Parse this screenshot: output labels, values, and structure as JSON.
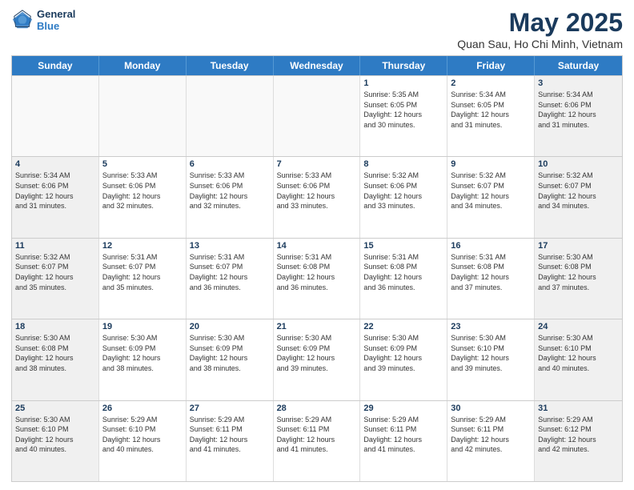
{
  "header": {
    "logo": {
      "general": "General",
      "blue": "Blue"
    },
    "title": "May 2025",
    "subtitle": "Quan Sau, Ho Chi Minh, Vietnam"
  },
  "days": [
    "Sunday",
    "Monday",
    "Tuesday",
    "Wednesday",
    "Thursday",
    "Friday",
    "Saturday"
  ],
  "weeks": [
    [
      {
        "day": "",
        "lines": []
      },
      {
        "day": "",
        "lines": []
      },
      {
        "day": "",
        "lines": []
      },
      {
        "day": "",
        "lines": []
      },
      {
        "day": "1",
        "lines": [
          "Sunrise: 5:35 AM",
          "Sunset: 6:05 PM",
          "Daylight: 12 hours",
          "and 30 minutes."
        ]
      },
      {
        "day": "2",
        "lines": [
          "Sunrise: 5:34 AM",
          "Sunset: 6:05 PM",
          "Daylight: 12 hours",
          "and 31 minutes."
        ]
      },
      {
        "day": "3",
        "lines": [
          "Sunrise: 5:34 AM",
          "Sunset: 6:06 PM",
          "Daylight: 12 hours",
          "and 31 minutes."
        ]
      }
    ],
    [
      {
        "day": "4",
        "lines": [
          "Sunrise: 5:34 AM",
          "Sunset: 6:06 PM",
          "Daylight: 12 hours",
          "and 31 minutes."
        ]
      },
      {
        "day": "5",
        "lines": [
          "Sunrise: 5:33 AM",
          "Sunset: 6:06 PM",
          "Daylight: 12 hours",
          "and 32 minutes."
        ]
      },
      {
        "day": "6",
        "lines": [
          "Sunrise: 5:33 AM",
          "Sunset: 6:06 PM",
          "Daylight: 12 hours",
          "and 32 minutes."
        ]
      },
      {
        "day": "7",
        "lines": [
          "Sunrise: 5:33 AM",
          "Sunset: 6:06 PM",
          "Daylight: 12 hours",
          "and 33 minutes."
        ]
      },
      {
        "day": "8",
        "lines": [
          "Sunrise: 5:32 AM",
          "Sunset: 6:06 PM",
          "Daylight: 12 hours",
          "and 33 minutes."
        ]
      },
      {
        "day": "9",
        "lines": [
          "Sunrise: 5:32 AM",
          "Sunset: 6:07 PM",
          "Daylight: 12 hours",
          "and 34 minutes."
        ]
      },
      {
        "day": "10",
        "lines": [
          "Sunrise: 5:32 AM",
          "Sunset: 6:07 PM",
          "Daylight: 12 hours",
          "and 34 minutes."
        ]
      }
    ],
    [
      {
        "day": "11",
        "lines": [
          "Sunrise: 5:32 AM",
          "Sunset: 6:07 PM",
          "Daylight: 12 hours",
          "and 35 minutes."
        ]
      },
      {
        "day": "12",
        "lines": [
          "Sunrise: 5:31 AM",
          "Sunset: 6:07 PM",
          "Daylight: 12 hours",
          "and 35 minutes."
        ]
      },
      {
        "day": "13",
        "lines": [
          "Sunrise: 5:31 AM",
          "Sunset: 6:07 PM",
          "Daylight: 12 hours",
          "and 36 minutes."
        ]
      },
      {
        "day": "14",
        "lines": [
          "Sunrise: 5:31 AM",
          "Sunset: 6:08 PM",
          "Daylight: 12 hours",
          "and 36 minutes."
        ]
      },
      {
        "day": "15",
        "lines": [
          "Sunrise: 5:31 AM",
          "Sunset: 6:08 PM",
          "Daylight: 12 hours",
          "and 36 minutes."
        ]
      },
      {
        "day": "16",
        "lines": [
          "Sunrise: 5:31 AM",
          "Sunset: 6:08 PM",
          "Daylight: 12 hours",
          "and 37 minutes."
        ]
      },
      {
        "day": "17",
        "lines": [
          "Sunrise: 5:30 AM",
          "Sunset: 6:08 PM",
          "Daylight: 12 hours",
          "and 37 minutes."
        ]
      }
    ],
    [
      {
        "day": "18",
        "lines": [
          "Sunrise: 5:30 AM",
          "Sunset: 6:08 PM",
          "Daylight: 12 hours",
          "and 38 minutes."
        ]
      },
      {
        "day": "19",
        "lines": [
          "Sunrise: 5:30 AM",
          "Sunset: 6:09 PM",
          "Daylight: 12 hours",
          "and 38 minutes."
        ]
      },
      {
        "day": "20",
        "lines": [
          "Sunrise: 5:30 AM",
          "Sunset: 6:09 PM",
          "Daylight: 12 hours",
          "and 38 minutes."
        ]
      },
      {
        "day": "21",
        "lines": [
          "Sunrise: 5:30 AM",
          "Sunset: 6:09 PM",
          "Daylight: 12 hours",
          "and 39 minutes."
        ]
      },
      {
        "day": "22",
        "lines": [
          "Sunrise: 5:30 AM",
          "Sunset: 6:09 PM",
          "Daylight: 12 hours",
          "and 39 minutes."
        ]
      },
      {
        "day": "23",
        "lines": [
          "Sunrise: 5:30 AM",
          "Sunset: 6:10 PM",
          "Daylight: 12 hours",
          "and 39 minutes."
        ]
      },
      {
        "day": "24",
        "lines": [
          "Sunrise: 5:30 AM",
          "Sunset: 6:10 PM",
          "Daylight: 12 hours",
          "and 40 minutes."
        ]
      }
    ],
    [
      {
        "day": "25",
        "lines": [
          "Sunrise: 5:30 AM",
          "Sunset: 6:10 PM",
          "Daylight: 12 hours",
          "and 40 minutes."
        ]
      },
      {
        "day": "26",
        "lines": [
          "Sunrise: 5:29 AM",
          "Sunset: 6:10 PM",
          "Daylight: 12 hours",
          "and 40 minutes."
        ]
      },
      {
        "day": "27",
        "lines": [
          "Sunrise: 5:29 AM",
          "Sunset: 6:11 PM",
          "Daylight: 12 hours",
          "and 41 minutes."
        ]
      },
      {
        "day": "28",
        "lines": [
          "Sunrise: 5:29 AM",
          "Sunset: 6:11 PM",
          "Daylight: 12 hours",
          "and 41 minutes."
        ]
      },
      {
        "day": "29",
        "lines": [
          "Sunrise: 5:29 AM",
          "Sunset: 6:11 PM",
          "Daylight: 12 hours",
          "and 41 minutes."
        ]
      },
      {
        "day": "30",
        "lines": [
          "Sunrise: 5:29 AM",
          "Sunset: 6:11 PM",
          "Daylight: 12 hours",
          "and 42 minutes."
        ]
      },
      {
        "day": "31",
        "lines": [
          "Sunrise: 5:29 AM",
          "Sunset: 6:12 PM",
          "Daylight: 12 hours",
          "and 42 minutes."
        ]
      }
    ]
  ]
}
